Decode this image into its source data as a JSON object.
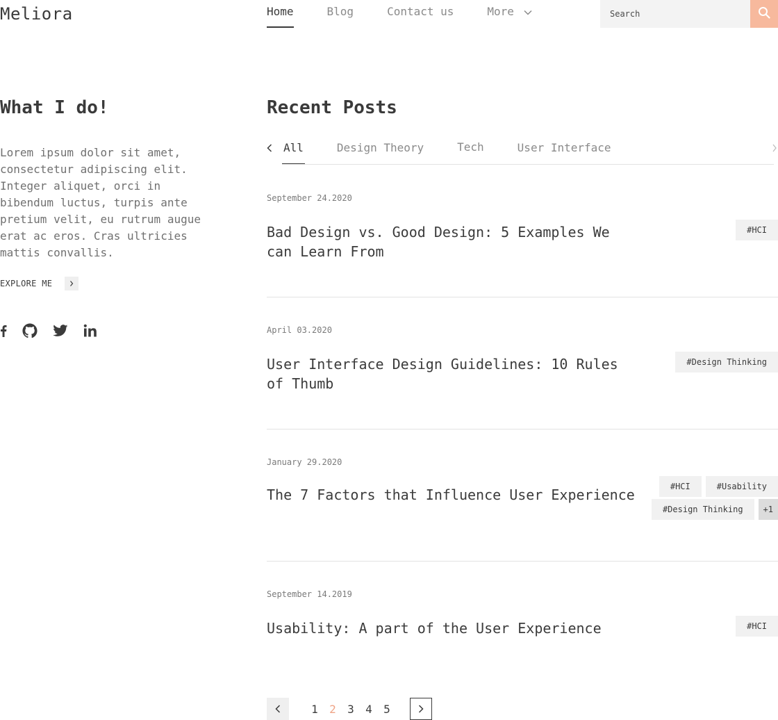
{
  "brand": "Meliora",
  "nav": {
    "items": [
      "Home",
      "Blog",
      "Contact us",
      "More"
    ],
    "active_index": 0
  },
  "search": {
    "placeholder": "Search",
    "icon": "search-icon"
  },
  "about": {
    "title": "What I do!",
    "text": "Lorem ipsum dolor sit amet, consectetur adipiscing elit. Integer aliquet, orci in bibendum luctus, turpis ante pretium velit, eu rutrum augue erat ac eros. Cras ultricies mattis convallis.",
    "cta": "EXPLORE ME"
  },
  "socials": [
    "facebook-icon",
    "github-icon",
    "twitter-icon",
    "linkedin-icon"
  ],
  "posts_section": {
    "title": "Recent Posts",
    "tabs": [
      "All",
      "Design Theory",
      "Tech",
      "User Interface"
    ],
    "active_tab": 0
  },
  "posts": [
    {
      "date": "September 24.2020",
      "title": "Bad Design vs. Good Design: 5 Examples We can Learn From",
      "tags": [
        "#HCI"
      ]
    },
    {
      "date": "April 03.2020",
      "title": "User Interface Design Guidelines: 10 Rules of Thumb",
      "tags": [
        "#Design Thinking"
      ]
    },
    {
      "date": "January 29.2020",
      "title": "The 7 Factors that Influence User Experience",
      "tags": [
        "#HCI",
        "#Usability",
        "#Design Thinking"
      ],
      "more": "+1"
    },
    {
      "date": "September 14.2019",
      "title": "Usability: A part of the User Experience",
      "tags": [
        "#HCI"
      ]
    }
  ],
  "pagination": {
    "pages": [
      "1",
      "2",
      "3",
      "4",
      "5"
    ],
    "current": "2"
  },
  "colors": {
    "accent": "#f7b99d",
    "accent_text": "#f0a487",
    "text": "#3b3b3b",
    "muted": "#8a8a8a",
    "tag_bg": "#f1f1f1"
  }
}
